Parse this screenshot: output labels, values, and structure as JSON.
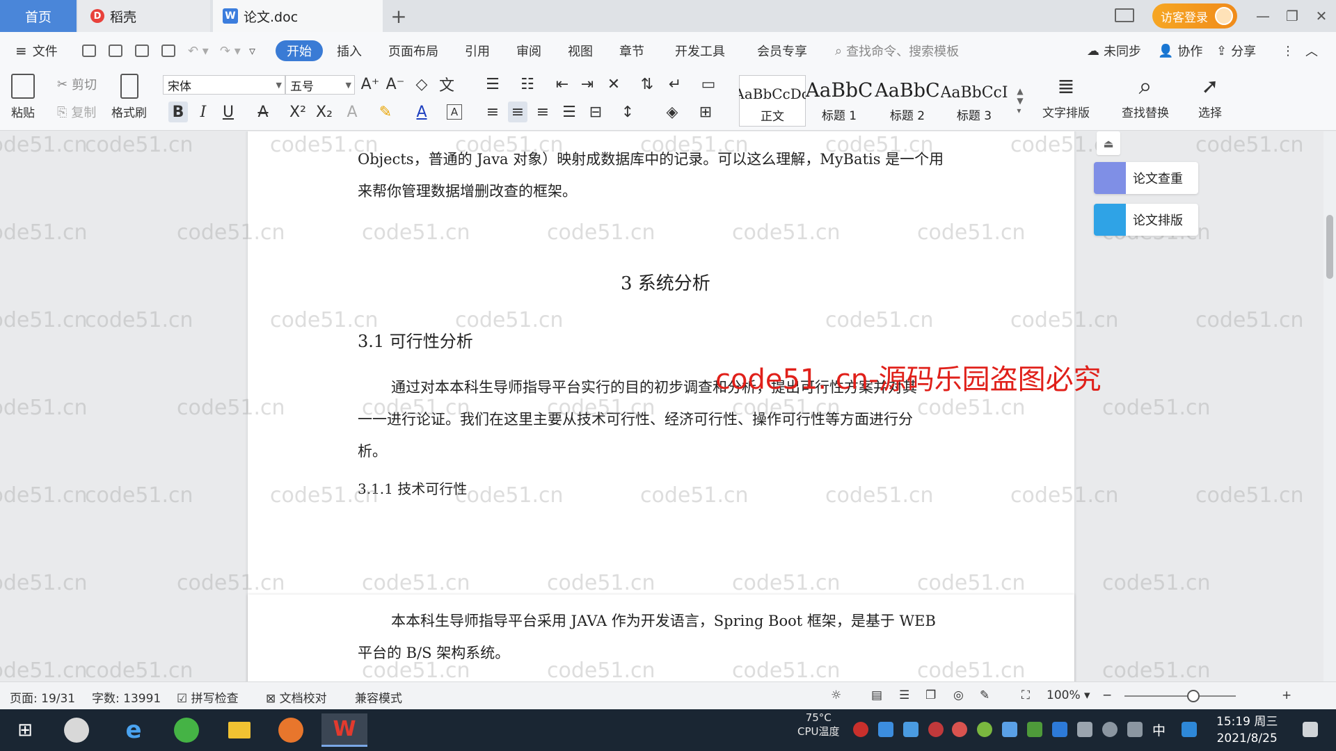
{
  "tabs": {
    "home": "首页",
    "docer": "稻壳",
    "doc": "论文.doc",
    "add": "+"
  },
  "titlebar": {
    "login": "访客登录"
  },
  "menu": {
    "file": "文件",
    "items": [
      "开始",
      "插入",
      "页面布局",
      "引用",
      "审阅",
      "视图",
      "章节",
      "开发工具",
      "会员专享"
    ],
    "search_placeholder": "查找命令、搜索模板",
    "sync": "未同步",
    "collab": "协作",
    "share": "分享"
  },
  "ribbon": {
    "paste": "粘贴",
    "cut": "剪切",
    "copy": "复制",
    "format_painter": "格式刷",
    "font_name": "宋体",
    "font_size": "五号",
    "styles": [
      {
        "sample": "AaBbCcDd",
        "name": "正文"
      },
      {
        "sample": "AaBbC",
        "name": "标题 1"
      },
      {
        "sample": "AaBbC",
        "name": "标题 2"
      },
      {
        "sample": "AaBbCcI",
        "name": "标题 3"
      }
    ],
    "text_layout": "文字排版",
    "find_replace": "查找替换",
    "select": "选择"
  },
  "document": {
    "para1_line1": "Objects，普通的 Java 对象）映射成数据库中的记录。可以这么理解，MyBatis 是一个用",
    "para1_line2": "来帮你管理数据增删改查的框架。",
    "heading_3": "3 系统分析",
    "heading_3_1": "3.1 可行性分析",
    "watermark_red": "code51. cn-源码乐园盗图必究",
    "para2_line1": "通过对本本科生导师指导平台实行的目的初步调查和分析，提出可行性方案并对其",
    "para2_line2": "一一进行论证。我们在这里主要从技术可行性、经济可行性、操作可行性等方面进行分",
    "para2_line3": "析。",
    "heading_3_1_1": "3.1.1 技术可行性",
    "para3_line1": "本本科生导师指导平台采用 JAVA 作为开发语言，Spring Boot 框架，是基于 WEB",
    "para3_line2": "平台的 B/S 架构系统。",
    "watermark": "code51.cn"
  },
  "side_panel": {
    "check": "论文查重",
    "layout": "论文排版"
  },
  "status": {
    "page": "页面: 19/31",
    "words": "字数: 13991",
    "spell": "拼写检查",
    "proof": "文档校对",
    "compat": "兼容模式",
    "zoom": "100%"
  },
  "taskbar": {
    "cpu_temp": "75°C",
    "cpu_label": "CPU温度",
    "ime": "中",
    "time": "15:19 周三",
    "date": "2021/8/25"
  },
  "colors": {
    "accent": "#3a7bd5",
    "login": "#f39c1e",
    "watermark_red": "#e0201a"
  }
}
